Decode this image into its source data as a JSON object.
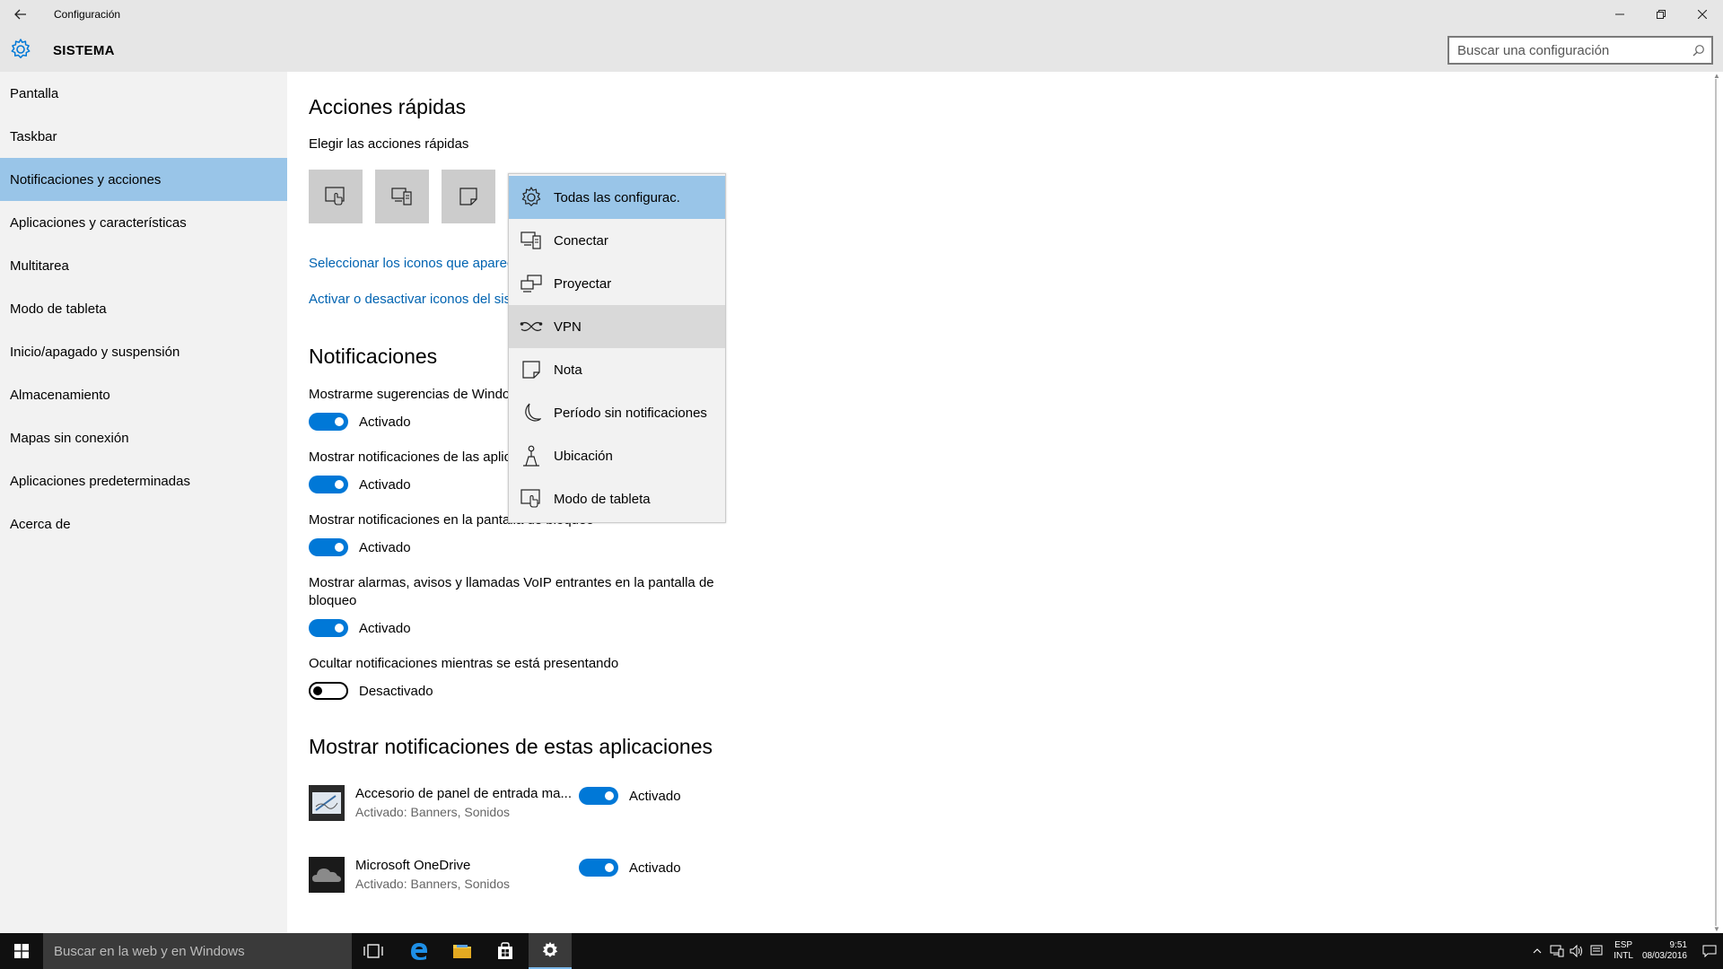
{
  "window": {
    "title": "Configuración"
  },
  "header": {
    "title": "SISTEMA",
    "search_placeholder": "Buscar una configuración"
  },
  "sidebar": {
    "items": [
      {
        "label": "Pantalla"
      },
      {
        "label": "Taskbar"
      },
      {
        "label": "Notificaciones y acciones",
        "selected": true
      },
      {
        "label": "Aplicaciones y características"
      },
      {
        "label": "Multitarea"
      },
      {
        "label": "Modo de tableta"
      },
      {
        "label": "Inicio/apagado y suspensión"
      },
      {
        "label": "Almacenamiento"
      },
      {
        "label": "Mapas sin conexión"
      },
      {
        "label": "Aplicaciones predeterminadas"
      },
      {
        "label": "Acerca de"
      }
    ]
  },
  "quick_actions": {
    "heading": "Acciones rápidas",
    "subheading": "Elegir las acciones rápidas",
    "link_icons": "Seleccionar los iconos que aparec",
    "link_system": "Activar o desactivar iconos del sis"
  },
  "notifications": {
    "heading": "Notificaciones",
    "items": [
      {
        "label": "Mostrarme sugerencias de Windo",
        "state": "Activado"
      },
      {
        "label": "Mostrar notificaciones de las aplic",
        "state": "Activado"
      },
      {
        "label": "Mostrar notificaciones en la pantalla de bloqueo",
        "state": "Activado"
      },
      {
        "label": "Mostrar alarmas, avisos y llamadas VoIP entrantes en la pantalla de bloqueo",
        "state": "Activado"
      },
      {
        "label": "Ocultar notificaciones mientras se está presentando",
        "state": "Desactivado"
      }
    ]
  },
  "apps_section": {
    "heading": "Mostrar notificaciones de estas aplicaciones",
    "apps": [
      {
        "name": "Accesorio de panel de entrada ma...",
        "sub": "Activado: Banners, Sonidos",
        "state": "Activado"
      },
      {
        "name": "Microsoft OneDrive",
        "sub": "Activado: Banners, Sonidos",
        "state": "Activado"
      }
    ]
  },
  "menu": {
    "items": [
      {
        "label": "Todas las configurac.",
        "icon": "gear-icon"
      },
      {
        "label": "Conectar",
        "icon": "connect-icon"
      },
      {
        "label": "Proyectar",
        "icon": "project-icon"
      },
      {
        "label": "VPN",
        "icon": "vpn-icon"
      },
      {
        "label": "Nota",
        "icon": "note-icon"
      },
      {
        "label": "Período sin notificaciones",
        "icon": "moon-icon"
      },
      {
        "label": "Ubicación",
        "icon": "location-icon"
      },
      {
        "label": "Modo de tableta",
        "icon": "tablet-mode-icon"
      }
    ]
  },
  "taskbar": {
    "search_text": "Buscar en la web y en Windows",
    "lang_top": "ESP",
    "lang_bottom": "INTL",
    "time": "9:51",
    "date": "08/03/2016"
  },
  "colors": {
    "accent": "#0078d7",
    "selection": "#99c5e8",
    "link": "#0063b1"
  }
}
